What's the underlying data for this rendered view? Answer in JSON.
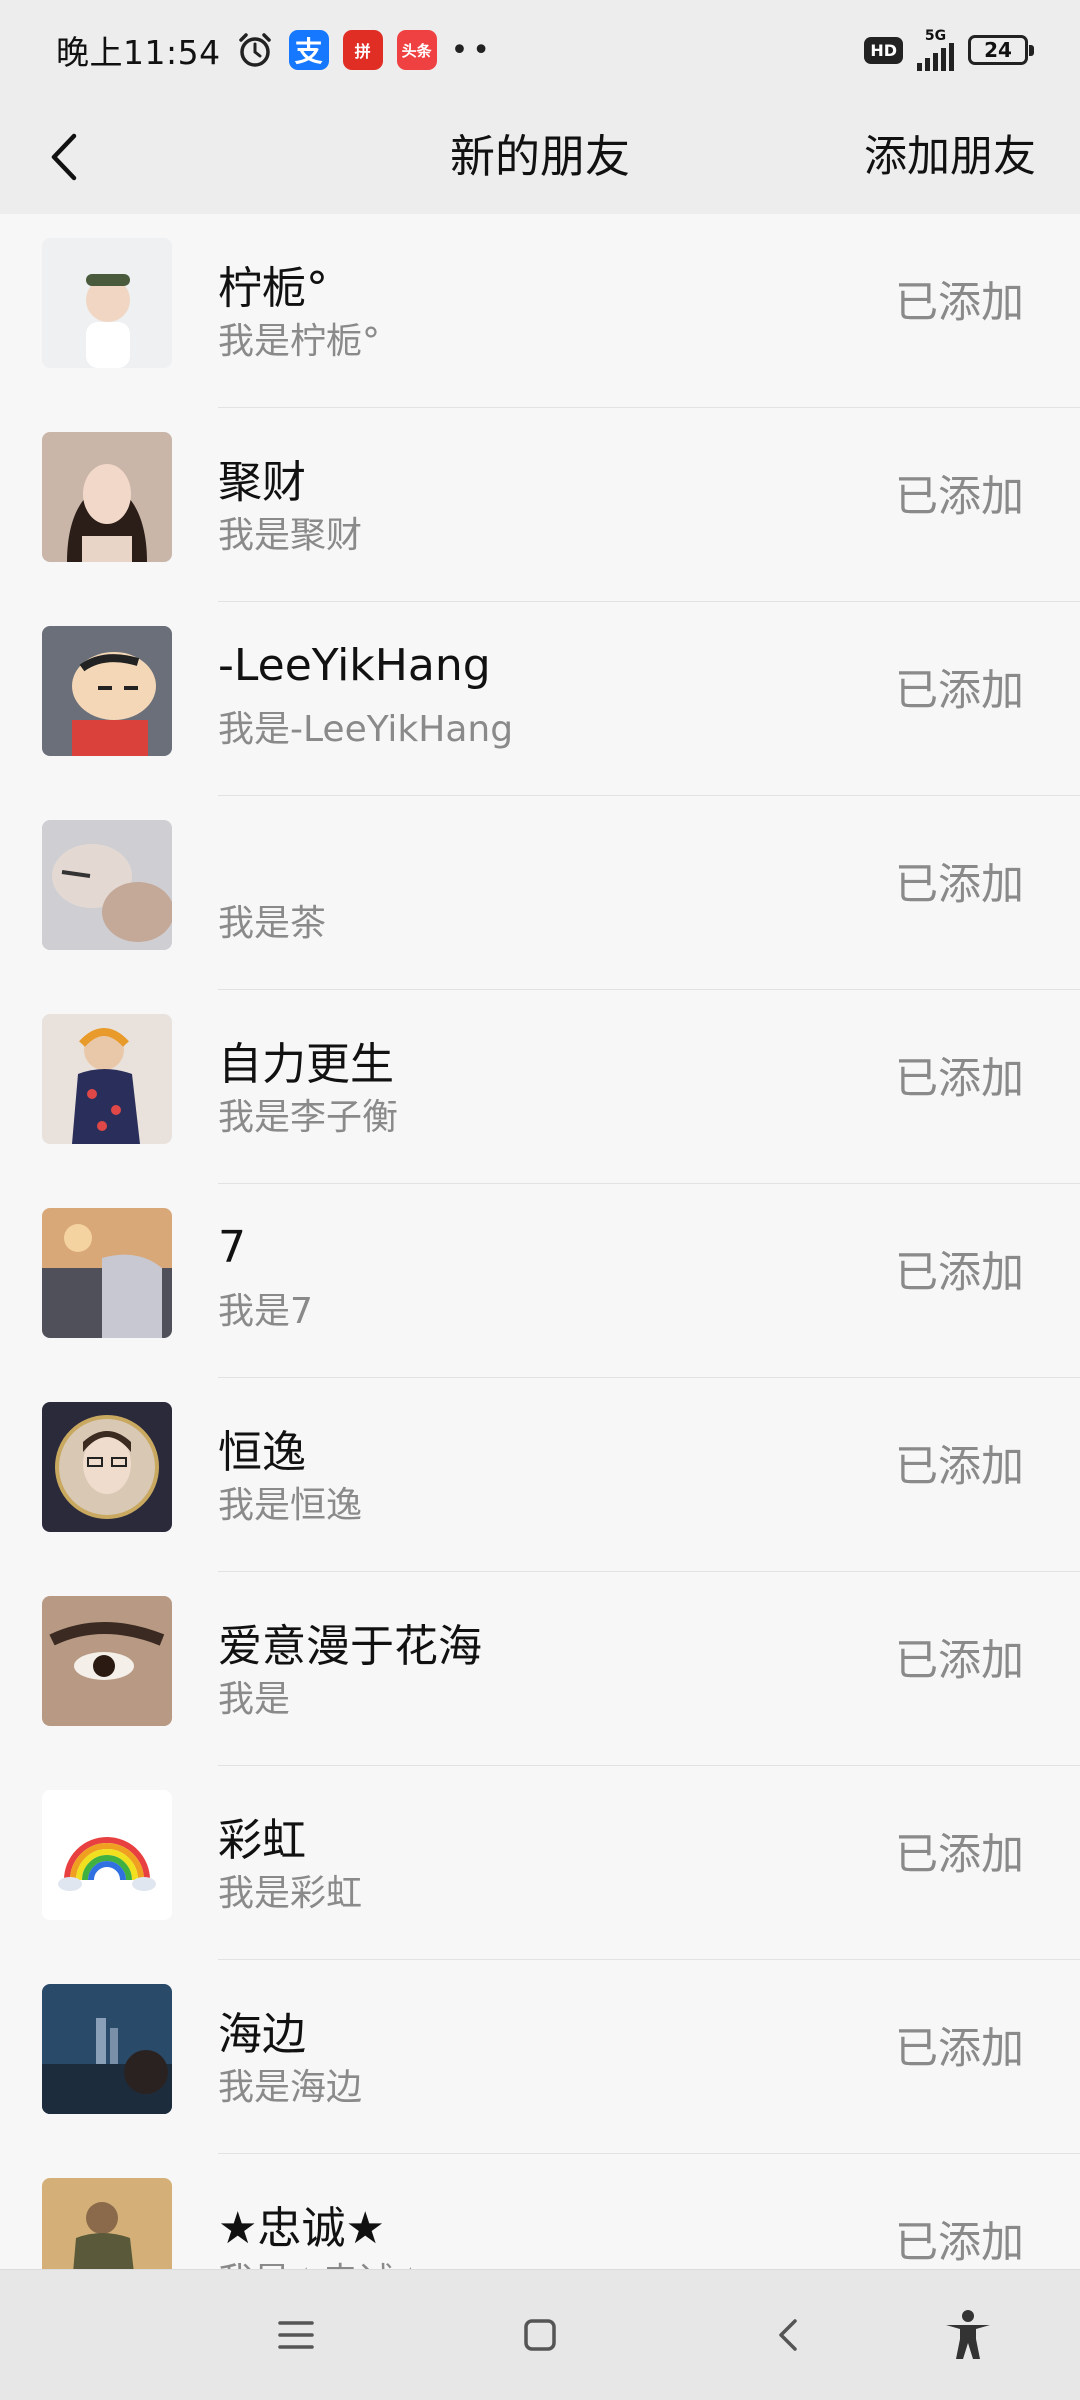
{
  "status_bar": {
    "time": "晚上11:54",
    "icons": [
      "alarm-icon",
      "alipay-icon",
      "pinduoduo-icon",
      "toutiao-icon"
    ],
    "alipay_glyph": "支",
    "pdd_glyph": "拼",
    "toutiao_glyph": "头条",
    "more": "••",
    "hd": "HD",
    "network": "5G",
    "battery": "24"
  },
  "nav": {
    "title": "新的朋友",
    "add_friend": "添加朋友"
  },
  "friends": [
    {
      "name": "柠栀°",
      "message": "我是柠栀°",
      "status": "已添加"
    },
    {
      "name": "聚财",
      "message": "我是聚财",
      "status": "已添加"
    },
    {
      "name": "-LeeYikHang",
      "message": "我是-LeeYikHang",
      "status": "已添加"
    },
    {
      "name": "",
      "message": "我是茶",
      "status": "已添加"
    },
    {
      "name": "自力更生",
      "message": "我是李子衡",
      "status": "已添加"
    },
    {
      "name": "7",
      "message": "我是7",
      "status": "已添加"
    },
    {
      "name": "恒逸",
      "message": "我是恒逸",
      "status": "已添加"
    },
    {
      "name": "爱意漫于花海",
      "message": "我是",
      "status": "已添加"
    },
    {
      "name": "彩虹",
      "message": "我是彩虹",
      "status": "已添加"
    },
    {
      "name": "海边",
      "message": "我是海边",
      "status": "已添加"
    },
    {
      "name": "★忠诚★",
      "message": "我是★忠诚★",
      "status": "已添加"
    }
  ],
  "system_nav": [
    "menu-icon",
    "home-icon",
    "back-icon",
    "accessibility-icon"
  ]
}
